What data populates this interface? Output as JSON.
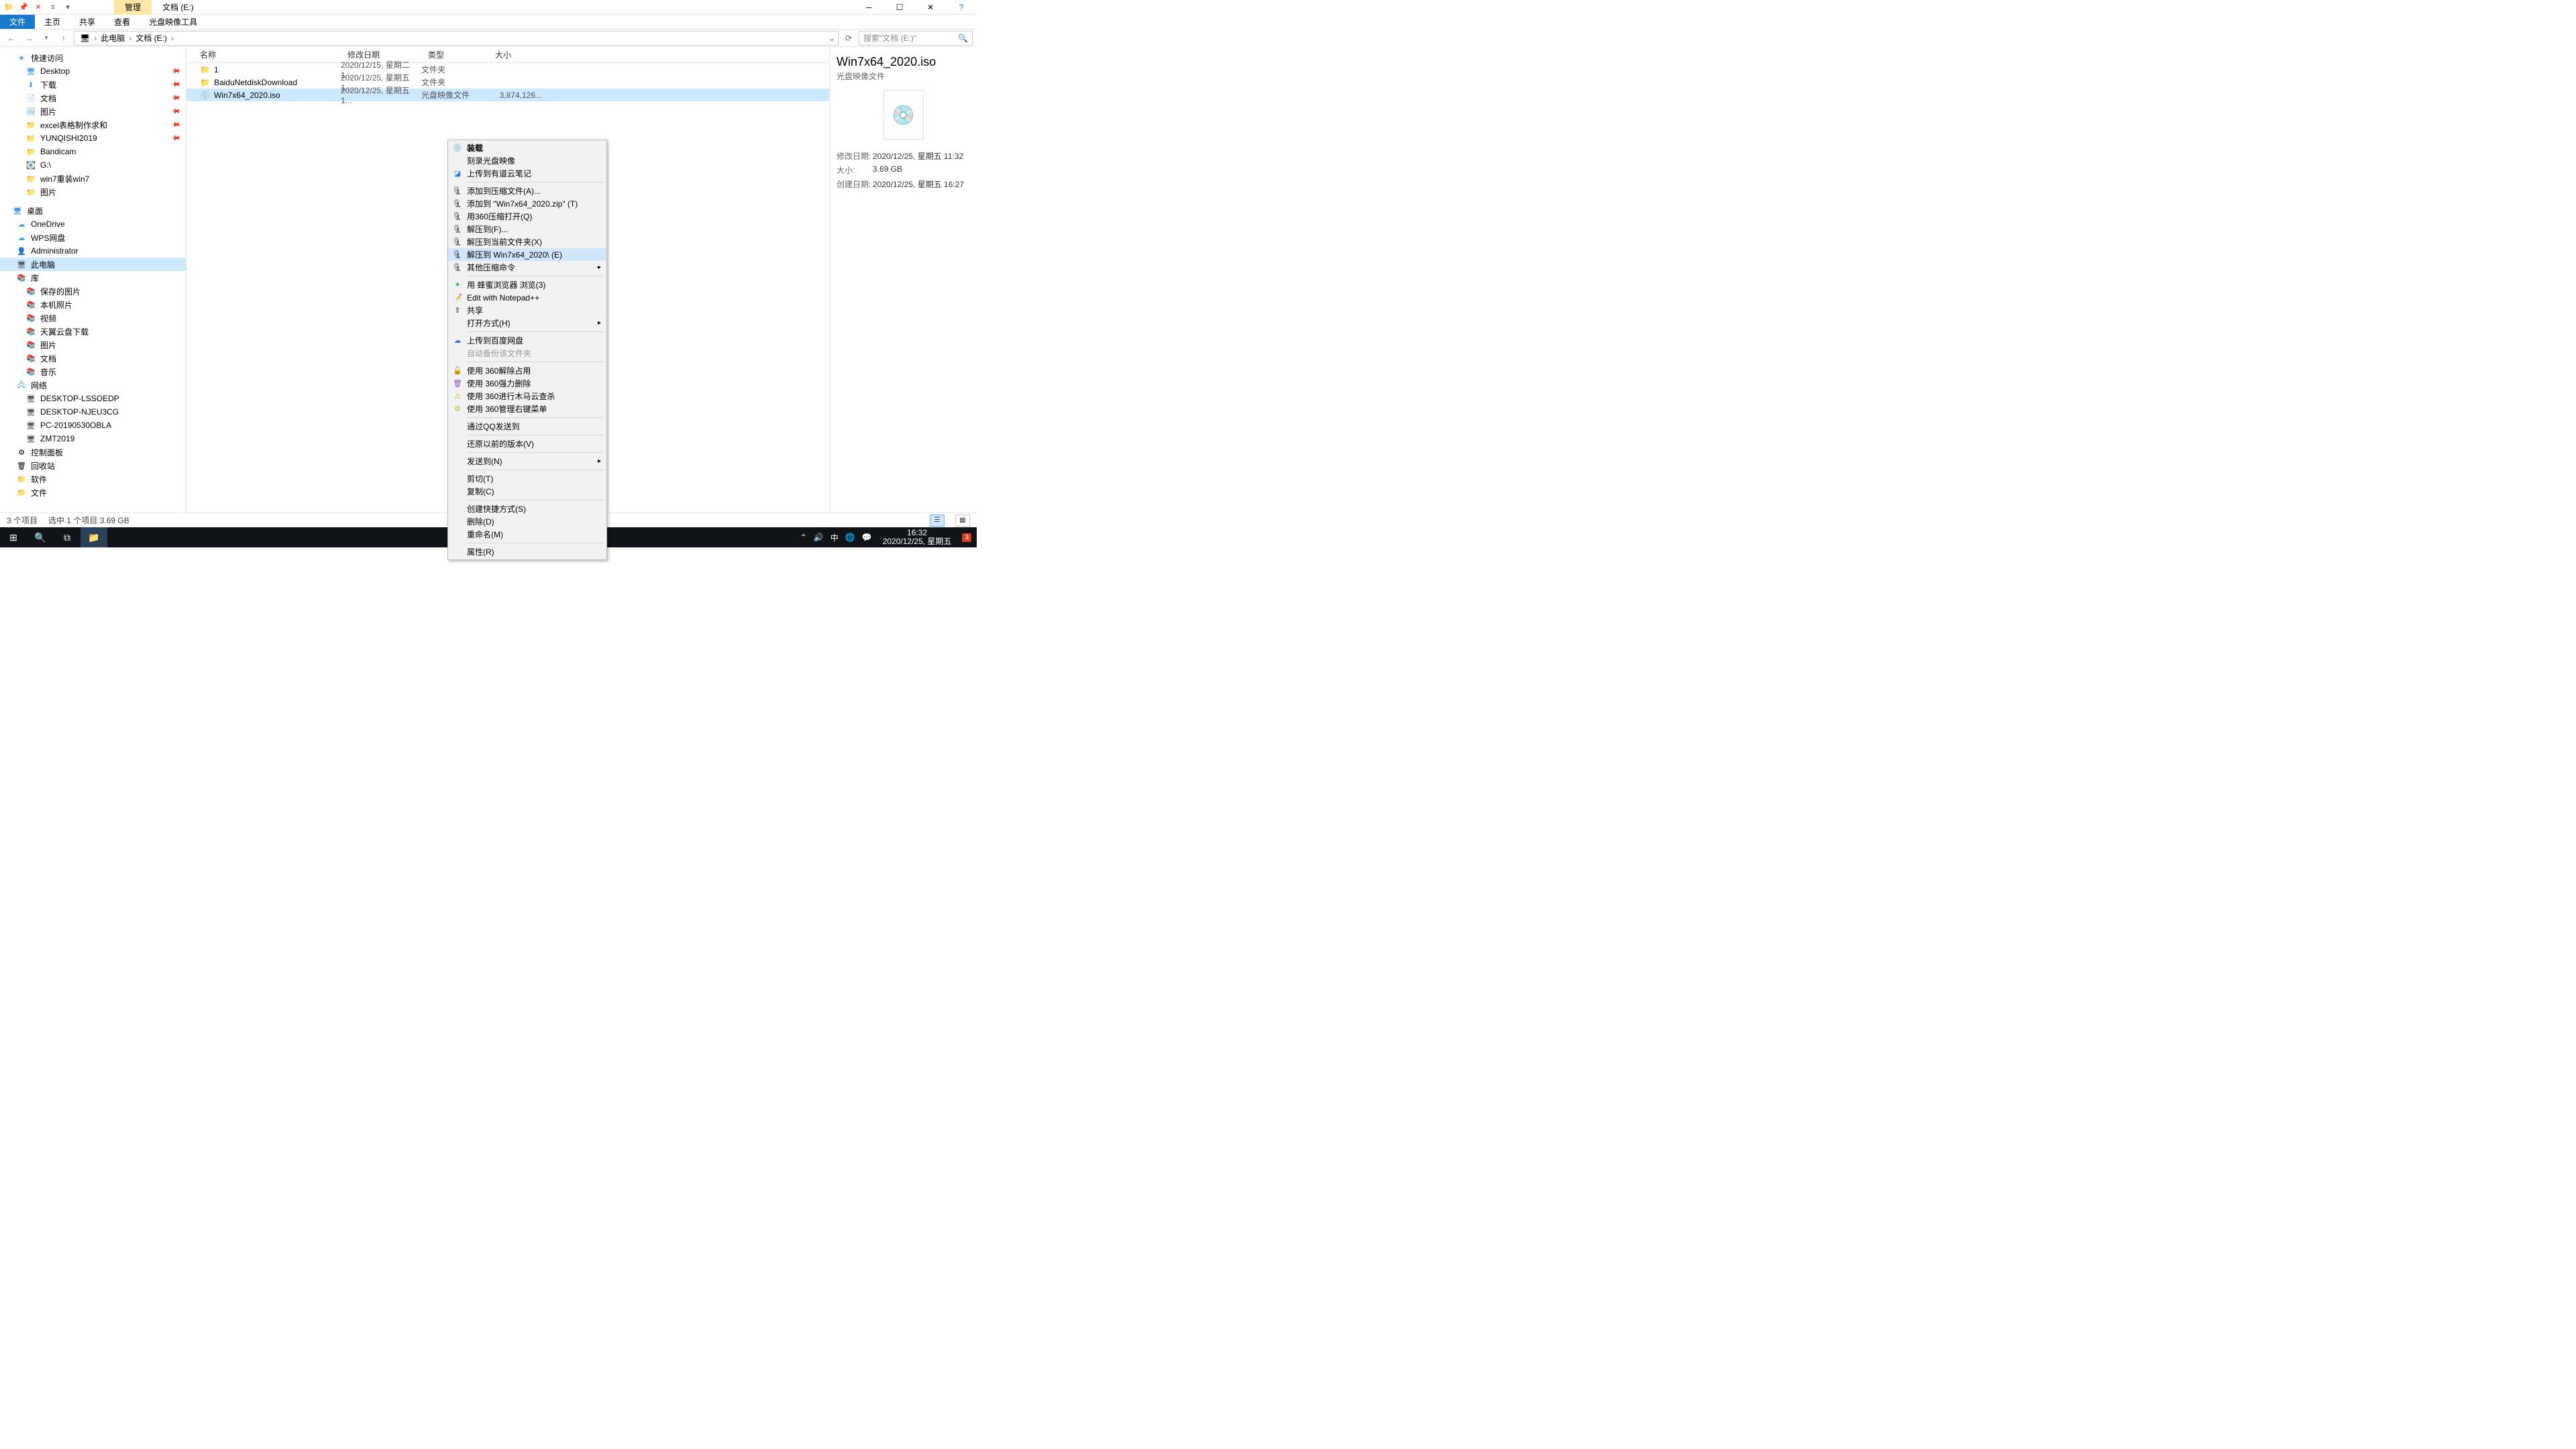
{
  "title_tabs": {
    "manage": "管理",
    "location": "文档 (E:)"
  },
  "ribbon": {
    "file": "文件",
    "home": "主页",
    "share": "共享",
    "view": "查看",
    "disc_tool": "光盘映像工具"
  },
  "breadcrumb": {
    "pc": "此电脑",
    "drive": "文档 (E:)"
  },
  "search": {
    "placeholder": "搜索\"文档 (E:)\""
  },
  "columns": {
    "name": "名称",
    "date": "修改日期",
    "type": "类型",
    "size": "大小"
  },
  "sidebar": {
    "quick": "快速访问",
    "items_quick": [
      "Desktop",
      "下载",
      "文档",
      "图片",
      "excel表格制作求和",
      "YUNQISHI2019",
      "Bandicam",
      "G:\\",
      "win7重装win7",
      "图片"
    ],
    "desktop": "桌面",
    "onedrive": "OneDrive",
    "wps": "WPS网盘",
    "admin": "Administrator",
    "pc": "此电脑",
    "lib": "库",
    "lib_items": [
      "保存的图片",
      "本机照片",
      "视频",
      "天翼云盘下载",
      "图片",
      "文档",
      "音乐"
    ],
    "network": "网络",
    "net_items": [
      "DESKTOP-LSSOEDP",
      "DESKTOP-NJEU3CG",
      "PC-20190530OBLA",
      "ZMT2019"
    ],
    "control": "控制面板",
    "recycle": "回收站",
    "soft": "软件",
    "files": "文件"
  },
  "rows": [
    {
      "name": "1",
      "date": "2020/12/15, 星期二 1...",
      "type": "文件夹",
      "size": ""
    },
    {
      "name": "BaiduNetdiskDownload",
      "date": "2020/12/25, 星期五 1...",
      "type": "文件夹",
      "size": ""
    },
    {
      "name": "Win7x64_2020.iso",
      "date": "2020/12/25, 星期五 1...",
      "type": "光盘映像文件",
      "size": "3,874,126..."
    }
  ],
  "details": {
    "title": "Win7x64_2020.iso",
    "sub": "光盘映像文件",
    "modified_lbl": "修改日期:",
    "modified": "2020/12/25, 星期五 11:32",
    "size_lbl": "大小:",
    "size": "3.69 GB",
    "created_lbl": "创建日期:",
    "created": "2020/12/25, 星期五 16:27"
  },
  "status": {
    "items": "3 个项目",
    "selected": "选中 1 个项目  3.69 GB"
  },
  "taskbar": {
    "time": "16:32",
    "date": "2020/12/25, 星期五",
    "ime": "中"
  },
  "context_menu": {
    "mount": "装载",
    "burn": "刻录光盘映像",
    "youdao": "上传到有道云笔记",
    "add_archive": "添加到压缩文件(A)...",
    "add_zip": "添加到 \"Win7x64_2020.zip\" (T)",
    "open_360zip": "用360压缩打开(Q)",
    "extract_to": "解压到(F)...",
    "extract_here": "解压到当前文件夹(X)",
    "extract_named": "解压到 Win7x64_2020\\ (E)",
    "other_zip": "其他压缩命令",
    "bee": "用 蜂蜜浏览器 浏览(3)",
    "npp": "Edit with Notepad++",
    "share": "共享",
    "openwith": "打开方式(H)",
    "baidu": "上传到百度网盘",
    "autobak": "自动备份该文件夹",
    "u360_unlock": "使用 360解除占用",
    "u360_del": "使用 360强力删除",
    "u360_scan": "使用 360进行木马云查杀",
    "u360_menu": "使用 360管理右键菜单",
    "qq": "通过QQ发送到",
    "restore": "还原以前的版本(V)",
    "sendto": "发送到(N)",
    "cut": "剪切(T)",
    "copy": "复制(C)",
    "shortcut": "创建快捷方式(S)",
    "delete": "删除(D)",
    "rename": "重命名(M)",
    "props": "属性(R)"
  }
}
